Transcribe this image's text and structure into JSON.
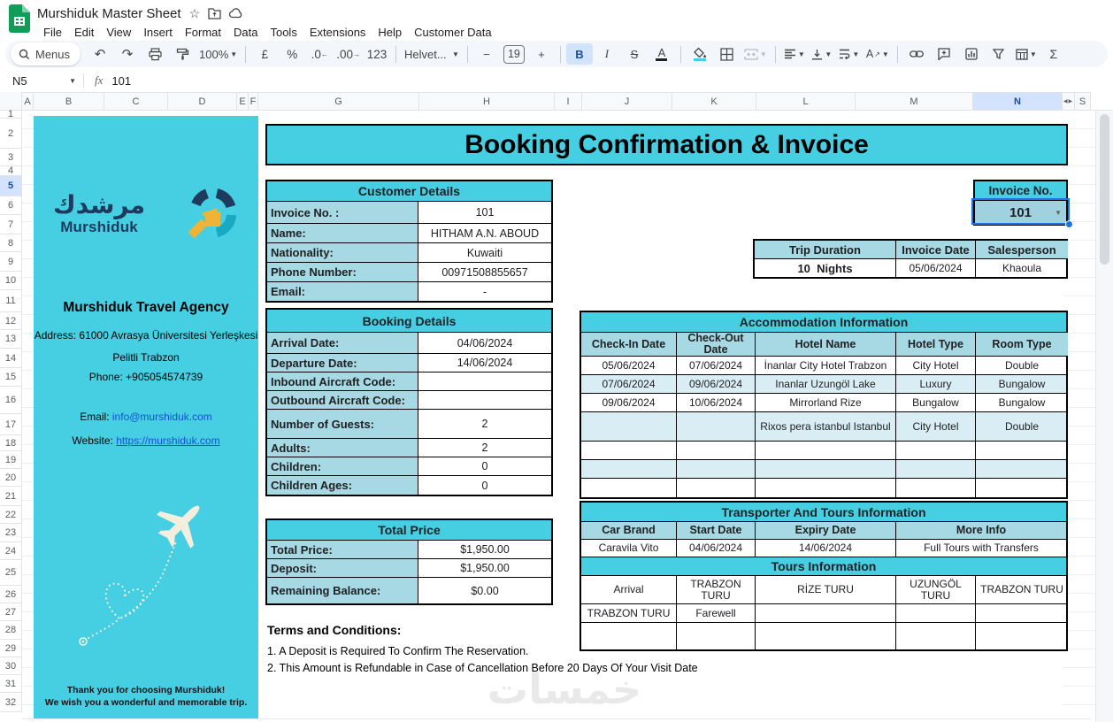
{
  "chrome": {
    "doc_title": "Murshiduk Master Sheet",
    "menu_items": [
      "File",
      "Edit",
      "View",
      "Insert",
      "Format",
      "Data",
      "Tools",
      "Extensions",
      "Help",
      "Customer Data"
    ],
    "toolbar": {
      "menus_label": "Menus",
      "zoom_value": "100%",
      "currency": "£",
      "percent": "%",
      "dec_decrease": ".0",
      "dec_increase": ".00",
      "number_format": "123",
      "font_name": "Helvet...",
      "font_size": "19",
      "minus": "−",
      "plus": "+",
      "bold": "B",
      "italic": "I",
      "strikethrough": "S",
      "text_color": "A",
      "functions": "Σ"
    },
    "formula_bar": {
      "cell_ref": "N5",
      "fx_label": "fx",
      "value": "101"
    },
    "column_headers": [
      "A",
      "B",
      "C",
      "D",
      "E",
      "F",
      "G",
      "H",
      "I",
      "J",
      "K",
      "L",
      "M",
      "N"
    ],
    "overflow_column": "S",
    "row_numbers": [
      "1",
      "2",
      "3",
      "4",
      "5",
      "6",
      "7",
      "8",
      "9",
      "10",
      "11",
      "12",
      "13",
      "14",
      "15",
      "16",
      "17",
      "18",
      "19",
      "20",
      "21",
      "22",
      "23",
      "24",
      "25",
      "26",
      "27",
      "28",
      "29",
      "30",
      "31",
      "32"
    ],
    "selected": {
      "column": "N",
      "row": "5"
    }
  },
  "sidebar": {
    "logo_arabic": "مرشدك",
    "logo_latin": "Murshiduk",
    "agency_name": "Murshiduk Travel Agency",
    "address_line1": "Address: 61000 Avrasya Üniversitesi Yerleşkesi",
    "address_line2": "Pelitli Trabzon",
    "phone": "Phone: +905054574739",
    "email_label": "Email: ",
    "email": "info@murshiduk.com",
    "website_label": "Website: ",
    "website": "https://murshiduk.com",
    "thanks_line1": "Thank you for choosing Murshiduk!",
    "thanks_line2": "We wish you a wonderful and memorable trip."
  },
  "invoice": {
    "title": "Booking Confirmation & Invoice",
    "customer": {
      "title": "Customer Details",
      "rows": [
        [
          "Invoice No. :",
          "101"
        ],
        [
          "Name:",
          "HITHAM A.N. ABOUD"
        ],
        [
          "Nationality:",
          "Kuwaiti"
        ],
        [
          "Phone Number:",
          "00971508855657"
        ],
        [
          "Email:",
          "-"
        ]
      ]
    },
    "invoice_no_box": {
      "title": "Invoice No.",
      "value": "101"
    },
    "trip": {
      "headers": [
        "Trip Duration",
        "Invoice Date",
        "Salesperson"
      ],
      "values": [
        "10  Nights",
        "05/06/2024",
        "Khaoula"
      ]
    },
    "booking": {
      "title": "Booking Details",
      "rows": [
        [
          "Arrival Date:",
          "04/06/2024"
        ],
        [
          "Departure Date:",
          "14/06/2024"
        ],
        [
          "Inbound Aircraft Code:",
          ""
        ],
        [
          "Outbound Aircraft Code:",
          ""
        ],
        [
          "Number of Guests:",
          "2"
        ],
        [
          "Adults:",
          "2"
        ],
        [
          "Children:",
          "0"
        ],
        [
          "Children Ages:",
          "0"
        ]
      ]
    },
    "accommodation": {
      "title": "Accommodation Information",
      "headers": [
        "Check-In Date",
        "Check-Out Date",
        "Hotel Name",
        "Hotel Type",
        "Room Type"
      ],
      "rows": [
        [
          "05/06/2024",
          "07/06/2024",
          "İnanlar City Hotel Trabzon",
          "City Hotel",
          "Double"
        ],
        [
          "07/06/2024",
          "09/06/2024",
          "Inanlar Uzungöl Lake",
          "Luxury",
          "Bungalow"
        ],
        [
          "09/06/2024",
          "10/06/2024",
          "Mirrorland Rize",
          "Bungalow",
          "Bungalow"
        ],
        [
          "",
          "",
          "Rixos pera istanbul Istanbul",
          "City Hotel",
          "Double"
        ],
        [
          "",
          "",
          "",
          "",
          ""
        ],
        [
          "",
          "",
          "",
          "",
          ""
        ],
        [
          "",
          "",
          "",
          "",
          ""
        ]
      ]
    },
    "totals": {
      "title": "Total Price",
      "rows": [
        [
          "Total Price:",
          "$1,950.00"
        ],
        [
          "Deposit:",
          "$1,950.00"
        ],
        [
          "Remaining Balance:",
          "$0.00"
        ]
      ]
    },
    "transporter": {
      "title": "Transporter And Tours Information",
      "headers": [
        "Car Brand",
        "Start Date",
        "Expiry Date",
        "More Info"
      ],
      "row": [
        "Caravila Vito",
        "04/06/2024",
        "14/06/2024",
        "Full Tours with Transfers"
      ],
      "tours_title": "Tours Information",
      "tours_rows": [
        [
          "Arrival",
          "TRABZON TURU",
          "RİZE TURU",
          "UZUNGÖL TURU",
          "TRABZON TURU"
        ],
        [
          "TRABZON TURU",
          "Farewell",
          "",
          "",
          ""
        ],
        [
          "",
          "",
          "",
          "",
          ""
        ]
      ]
    },
    "terms": {
      "title": "Terms and Conditions:",
      "items": [
        "1. A Deposit is Required To Confirm The Reservation.",
        "2. This Amount is Refundable in Case of Cancellation Before 20 Days Of Your Visit Date"
      ]
    }
  },
  "watermark": "خمسات",
  "colors": {
    "teal": "#46cfe2",
    "light_teal": "#a6d9e3",
    "alt_row": "#d9eef4",
    "navy": "#1e3a5c",
    "accent_yellow": "#f0b335",
    "link_blue": "#1155cc",
    "selection_blue": "#1a73e8",
    "sheets_green": "#0f9d58"
  }
}
